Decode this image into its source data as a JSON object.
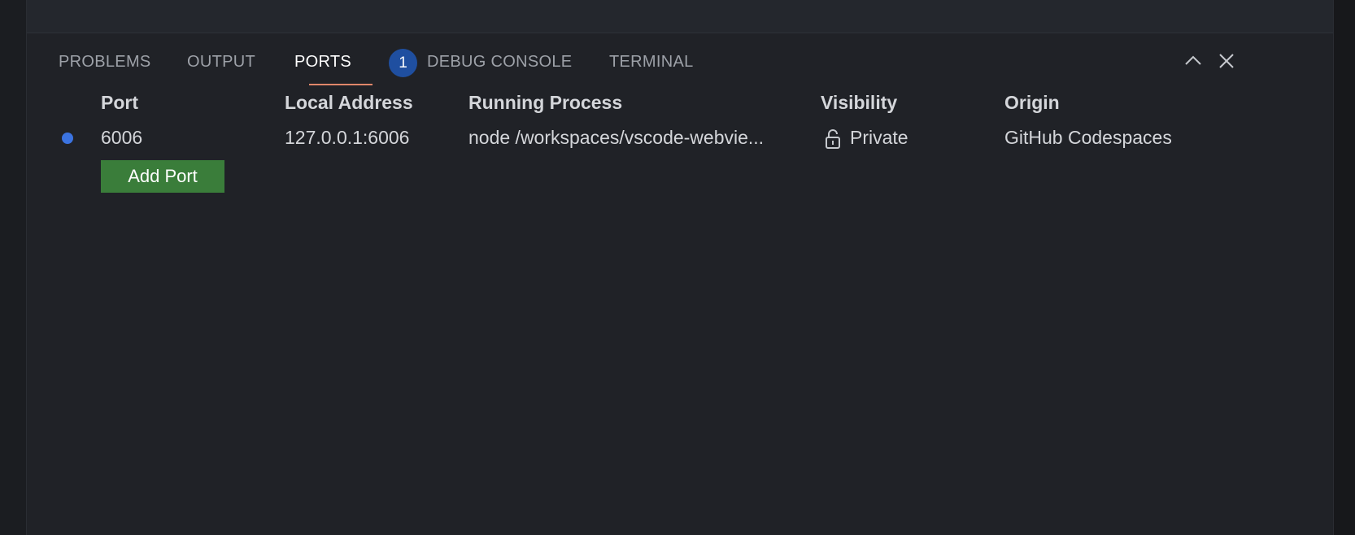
{
  "panel": {
    "tabs": [
      {
        "label": "PROBLEMS"
      },
      {
        "label": "OUTPUT"
      },
      {
        "label": "PORTS",
        "badge": "1",
        "active": true
      },
      {
        "label": "DEBUG CONSOLE"
      },
      {
        "label": "TERMINAL"
      }
    ],
    "actions": [
      {
        "icon": "chevron-up-icon"
      },
      {
        "icon": "close-icon"
      }
    ]
  },
  "ports_table": {
    "headers": [
      "Port",
      "Local Address",
      "Running Process",
      "Visibility",
      "Origin"
    ],
    "rows": [
      {
        "port": "6006",
        "local_address": "127.0.0.1:6006",
        "running_process": "node /workspaces/vscode-webvie...",
        "visibility": "Private",
        "visibility_icon": "lock-icon",
        "origin": "GitHub Codespaces",
        "status_color": "#3b73e0"
      }
    ],
    "add_port_label": "Add Port"
  },
  "colors": {
    "background": "#202227",
    "active_tab_underline": "#e0876a",
    "badge": "#1f4fa0",
    "add_port_button": "#3a7d3a"
  }
}
